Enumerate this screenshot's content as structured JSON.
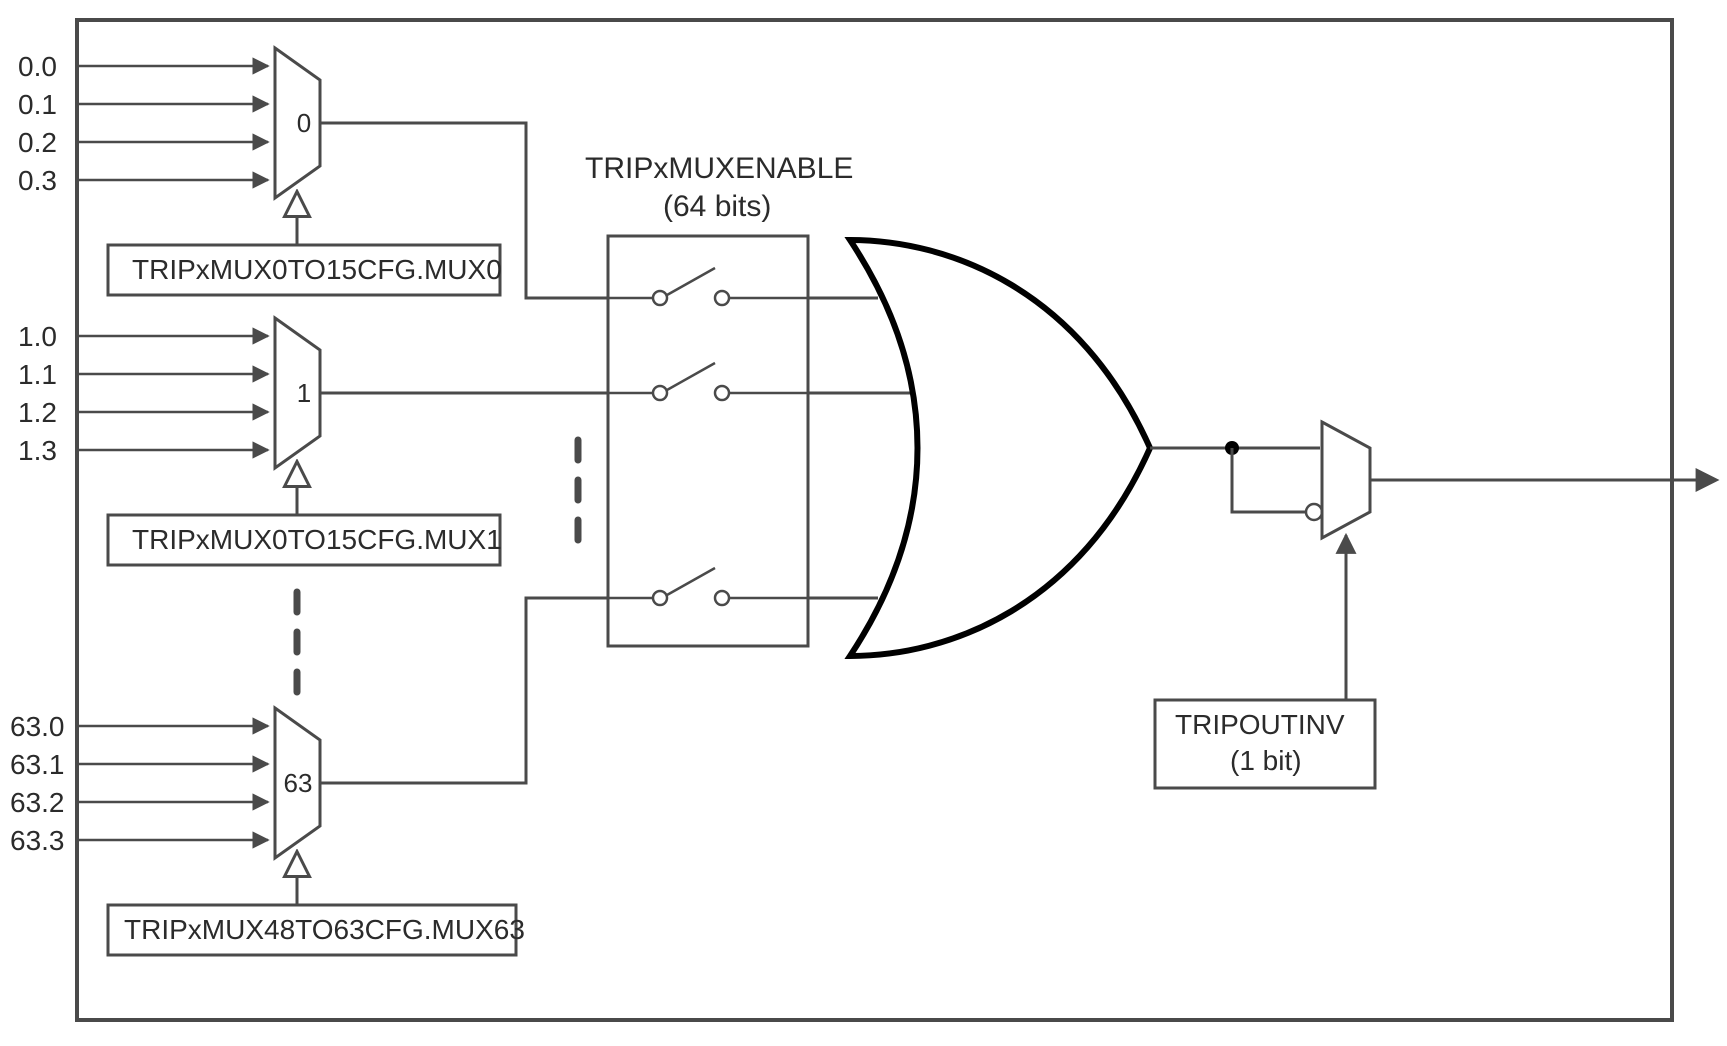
{
  "mux0": {
    "inputs": [
      "0.0",
      "0.1",
      "0.2",
      "0.3"
    ],
    "number": "0",
    "cfg": "TRIPxMUX0TO15CFG.MUX0"
  },
  "mux1": {
    "inputs": [
      "1.0",
      "1.1",
      "1.2",
      "1.3"
    ],
    "number": "1",
    "cfg": "TRIPxMUX0TO15CFG.MUX1"
  },
  "mux63": {
    "inputs": [
      "63.0",
      "63.1",
      "63.2",
      "63.3"
    ],
    "number": "63",
    "cfg": "TRIPxMUX48TO63CFG.MUX63"
  },
  "enable": {
    "title": "TRIPxMUXENABLE",
    "bits": "(64 bits)"
  },
  "outinv": {
    "title": "TRIPOUTINV",
    "bits": "(1 bit)"
  }
}
